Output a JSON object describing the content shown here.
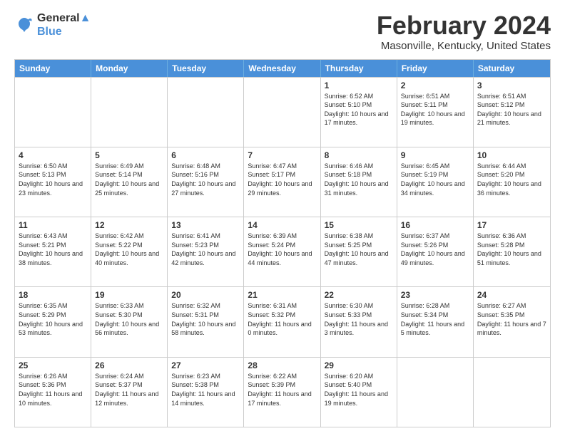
{
  "logo": {
    "line1": "General",
    "line2": "Blue"
  },
  "title": "February 2024",
  "subtitle": "Masonville, Kentucky, United States",
  "headers": [
    "Sunday",
    "Monday",
    "Tuesday",
    "Wednesday",
    "Thursday",
    "Friday",
    "Saturday"
  ],
  "weeks": [
    [
      {
        "day": "",
        "info": ""
      },
      {
        "day": "",
        "info": ""
      },
      {
        "day": "",
        "info": ""
      },
      {
        "day": "",
        "info": ""
      },
      {
        "day": "1",
        "info": "Sunrise: 6:52 AM\nSunset: 5:10 PM\nDaylight: 10 hours and 17 minutes."
      },
      {
        "day": "2",
        "info": "Sunrise: 6:51 AM\nSunset: 5:11 PM\nDaylight: 10 hours and 19 minutes."
      },
      {
        "day": "3",
        "info": "Sunrise: 6:51 AM\nSunset: 5:12 PM\nDaylight: 10 hours and 21 minutes."
      }
    ],
    [
      {
        "day": "4",
        "info": "Sunrise: 6:50 AM\nSunset: 5:13 PM\nDaylight: 10 hours and 23 minutes."
      },
      {
        "day": "5",
        "info": "Sunrise: 6:49 AM\nSunset: 5:14 PM\nDaylight: 10 hours and 25 minutes."
      },
      {
        "day": "6",
        "info": "Sunrise: 6:48 AM\nSunset: 5:16 PM\nDaylight: 10 hours and 27 minutes."
      },
      {
        "day": "7",
        "info": "Sunrise: 6:47 AM\nSunset: 5:17 PM\nDaylight: 10 hours and 29 minutes."
      },
      {
        "day": "8",
        "info": "Sunrise: 6:46 AM\nSunset: 5:18 PM\nDaylight: 10 hours and 31 minutes."
      },
      {
        "day": "9",
        "info": "Sunrise: 6:45 AM\nSunset: 5:19 PM\nDaylight: 10 hours and 34 minutes."
      },
      {
        "day": "10",
        "info": "Sunrise: 6:44 AM\nSunset: 5:20 PM\nDaylight: 10 hours and 36 minutes."
      }
    ],
    [
      {
        "day": "11",
        "info": "Sunrise: 6:43 AM\nSunset: 5:21 PM\nDaylight: 10 hours and 38 minutes."
      },
      {
        "day": "12",
        "info": "Sunrise: 6:42 AM\nSunset: 5:22 PM\nDaylight: 10 hours and 40 minutes."
      },
      {
        "day": "13",
        "info": "Sunrise: 6:41 AM\nSunset: 5:23 PM\nDaylight: 10 hours and 42 minutes."
      },
      {
        "day": "14",
        "info": "Sunrise: 6:39 AM\nSunset: 5:24 PM\nDaylight: 10 hours and 44 minutes."
      },
      {
        "day": "15",
        "info": "Sunrise: 6:38 AM\nSunset: 5:25 PM\nDaylight: 10 hours and 47 minutes."
      },
      {
        "day": "16",
        "info": "Sunrise: 6:37 AM\nSunset: 5:26 PM\nDaylight: 10 hours and 49 minutes."
      },
      {
        "day": "17",
        "info": "Sunrise: 6:36 AM\nSunset: 5:28 PM\nDaylight: 10 hours and 51 minutes."
      }
    ],
    [
      {
        "day": "18",
        "info": "Sunrise: 6:35 AM\nSunset: 5:29 PM\nDaylight: 10 hours and 53 minutes."
      },
      {
        "day": "19",
        "info": "Sunrise: 6:33 AM\nSunset: 5:30 PM\nDaylight: 10 hours and 56 minutes."
      },
      {
        "day": "20",
        "info": "Sunrise: 6:32 AM\nSunset: 5:31 PM\nDaylight: 10 hours and 58 minutes."
      },
      {
        "day": "21",
        "info": "Sunrise: 6:31 AM\nSunset: 5:32 PM\nDaylight: 11 hours and 0 minutes."
      },
      {
        "day": "22",
        "info": "Sunrise: 6:30 AM\nSunset: 5:33 PM\nDaylight: 11 hours and 3 minutes."
      },
      {
        "day": "23",
        "info": "Sunrise: 6:28 AM\nSunset: 5:34 PM\nDaylight: 11 hours and 5 minutes."
      },
      {
        "day": "24",
        "info": "Sunrise: 6:27 AM\nSunset: 5:35 PM\nDaylight: 11 hours and 7 minutes."
      }
    ],
    [
      {
        "day": "25",
        "info": "Sunrise: 6:26 AM\nSunset: 5:36 PM\nDaylight: 11 hours and 10 minutes."
      },
      {
        "day": "26",
        "info": "Sunrise: 6:24 AM\nSunset: 5:37 PM\nDaylight: 11 hours and 12 minutes."
      },
      {
        "day": "27",
        "info": "Sunrise: 6:23 AM\nSunset: 5:38 PM\nDaylight: 11 hours and 14 minutes."
      },
      {
        "day": "28",
        "info": "Sunrise: 6:22 AM\nSunset: 5:39 PM\nDaylight: 11 hours and 17 minutes."
      },
      {
        "day": "29",
        "info": "Sunrise: 6:20 AM\nSunset: 5:40 PM\nDaylight: 11 hours and 19 minutes."
      },
      {
        "day": "",
        "info": ""
      },
      {
        "day": "",
        "info": ""
      }
    ]
  ]
}
